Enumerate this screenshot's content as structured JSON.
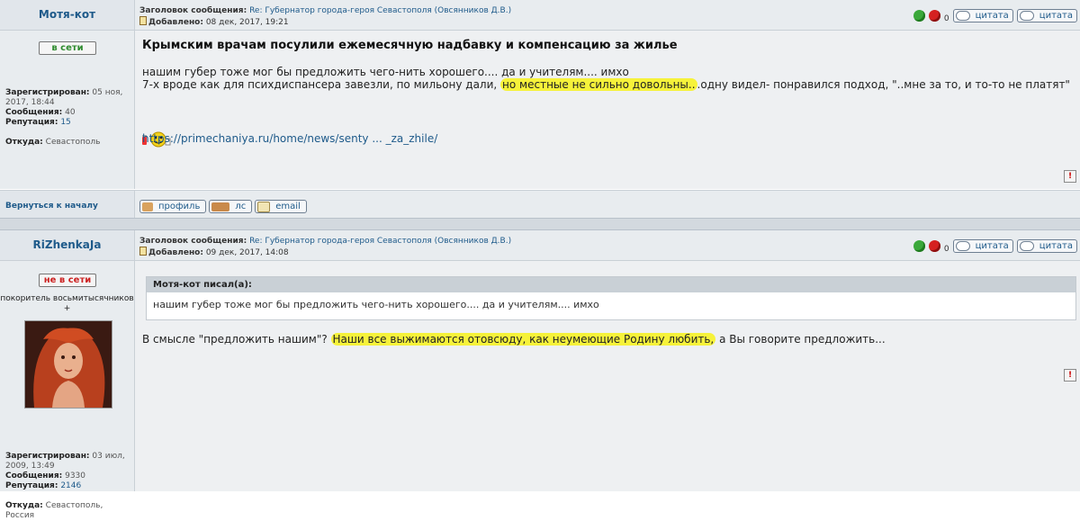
{
  "posts": [
    {
      "author": "Мотя-кот",
      "status": "в сети",
      "rank": "",
      "registered_label": "Зарегистрирован:",
      "registered_value": "05 ноя, 2017, 18:44",
      "messages_label": "Сообщения:",
      "messages_value": "40",
      "reputation_label": "Репутация:",
      "reputation_value": "15",
      "location_label": "Откуда:",
      "location_value": "Севастополь",
      "subject_label": "Заголовок сообщения:",
      "subject": "Re: Губернатор города-героя Севастополя (Овсянников Д.В.)",
      "added_label": "Добавлено:",
      "added": "08 дек, 2017, 19:21",
      "rating_count": "0",
      "quote_buttons": [
        "цитата",
        "цитата"
      ],
      "title": "Крымским врачам посулили ежемесячную надбавку и компенсацию за жилье",
      "line1": "нашим губер тоже мог бы предложить чего-нить хорошего.... да и учителям.... имхо",
      "line2_a": "7-х вроде как для психдиспансера завезли, по мильону дали, ",
      "line2_hl": "но местные не сильно довольны..",
      "line2_b": ".одну видел- понравился подход, \"..мне за то, и то-то не платят\"",
      "link": "https://primechaniya.ru/home/news/senty ... _za_zhile/",
      "back_to_top": "Вернуться к началу",
      "footer_buttons": [
        "профиль",
        "лс",
        "email"
      ],
      "report": "!"
    },
    {
      "author": "RiZhenkaJa",
      "status": "не в сети",
      "rank": "покоритель восьмитысячников +",
      "registered_label": "Зарегистрирован:",
      "registered_value": "03 июл, 2009, 13:49",
      "messages_label": "Сообщения:",
      "messages_value": "9330",
      "reputation_label": "Репутация:",
      "reputation_value": "2146",
      "location_label": "Откуда:",
      "location_value": "Севастополь, Россия",
      "subject_label": "Заголовок сообщения:",
      "subject": "Re: Губернатор города-героя Севастополя (Овсянников Д.В.)",
      "added_label": "Добавлено:",
      "added": "09 дек, 2017, 14:08",
      "rating_count": "0",
      "quote_buttons": [
        "цитата",
        "цитата"
      ],
      "quote_header": "Мотя-кот писал(а):",
      "quote_text": "нашим губер тоже мог бы предложить чего-нить хорошего.... да и учителям.... имхо",
      "reply_a": "В смысле \"предложить нашим\"? ",
      "reply_hl": "Наши все выжимаются отовсюду, как неумеющие Родину любить,",
      "reply_b": " а Вы говорите предложить...",
      "report": "!"
    }
  ],
  "colors": {
    "link": "#1e5a8a",
    "online": "#2e8b2e",
    "offline": "#cc2222",
    "highlight": "#f6f23a"
  }
}
